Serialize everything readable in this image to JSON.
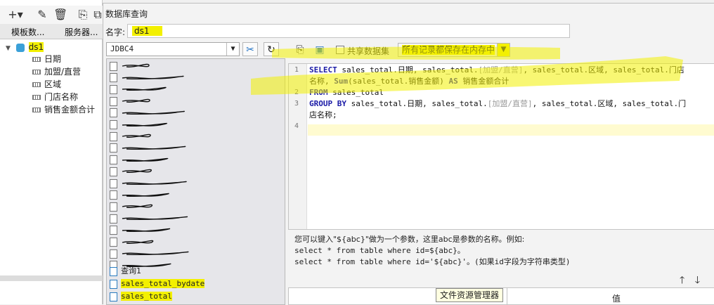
{
  "left_panel": {
    "tabs": [
      "模板数...",
      "服务器..."
    ],
    "dataset": {
      "name": "ds1",
      "fields": [
        "日期",
        "加盟/直营",
        "区域",
        "门店名称",
        "销售金额合计"
      ]
    }
  },
  "dialog": {
    "title": "数据库查询",
    "name_label": "名字:",
    "name_value": "ds1",
    "connection": "JDBC4",
    "share_label": "共享数据集",
    "memory_option": "所有记录都保存在内存中",
    "tables_visible": [
      "查询1",
      "sales_total_bydate",
      "sales_total"
    ],
    "sql": {
      "line_numbers": [
        "1",
        "2",
        "3",
        "4"
      ],
      "l1a": "SELECT",
      "l1b": " sales_total.日期, sales_total.",
      "l1c": "[加盟/直营]",
      "l1d": ", sales_total.区域, sales_total.门店",
      "l1e": "名称, ",
      "l1f": "Sum",
      "l1g": "(sales_total.销售金额) ",
      "l1h": "AS",
      "l1i": " 销售金额合计",
      "l2a": "FROM",
      "l2b": " sales_total",
      "l3a": "GROUP BY",
      "l3b": " sales_total.日期, sales_total.",
      "l3c": "[加盟/直营]",
      "l3d": ", sales_total.区域, sales_total.门",
      "l3e": "店名称;"
    },
    "help": {
      "line1": "您可以键入\"${abc}\"做为一个参数，这里abc是参数的名称。例如:",
      "line2": "select * from table where id=${abc}。",
      "line3": "select * from table where id='${abc}'。(如果id字段为字符串类型)"
    },
    "param_table": {
      "value_header": "值"
    },
    "tooltip": "文件资源管理器"
  },
  "colors": {
    "highlight": "#f3f000",
    "keyword": "#1a1aa6"
  }
}
